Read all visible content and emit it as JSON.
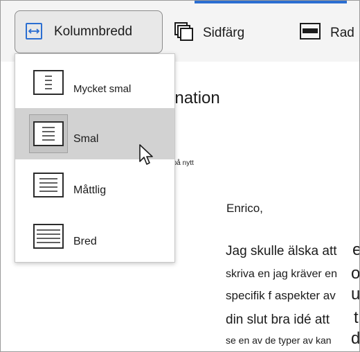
{
  "toolbar": {
    "column_width_label": "Kolumnbredd",
    "page_color_label": "Sidfärg",
    "row_label": "Rad",
    "icons": {
      "column_width": "column-width-icon",
      "page_color": "page-color-icon",
      "row": "row-icon"
    }
  },
  "dropdown": {
    "items": [
      {
        "label": "Mycket smal",
        "icon": "very-narrow-column-icon",
        "selected": false
      },
      {
        "label": "Smal",
        "icon": "narrow-column-icon",
        "selected": true
      },
      {
        "label": "Måttlig",
        "icon": "moderate-column-icon",
        "selected": false
      },
      {
        "label": "Bred",
        "icon": "wide-column-icon",
        "selected": false
      }
    ]
  },
  "document": {
    "heading_fragment": "enation",
    "small_fragment_t": "t",
    "small_fragment_text": "på nytt",
    "greeting": "Enrico,",
    "lines": [
      "Jag skulle älska att",
      "skriva en jag kräver en",
      "specifik f aspekter av",
      "din slut bra idé att",
      "se en av de typer av kan"
    ],
    "edge_chars": [
      "e",
      "o",
      "u",
      "t",
      "d"
    ]
  },
  "colors": {
    "toolbar_bg": "#f4f4f4",
    "accent": "#2b6ed1",
    "selected_item_bg": "#d2d2d2"
  }
}
